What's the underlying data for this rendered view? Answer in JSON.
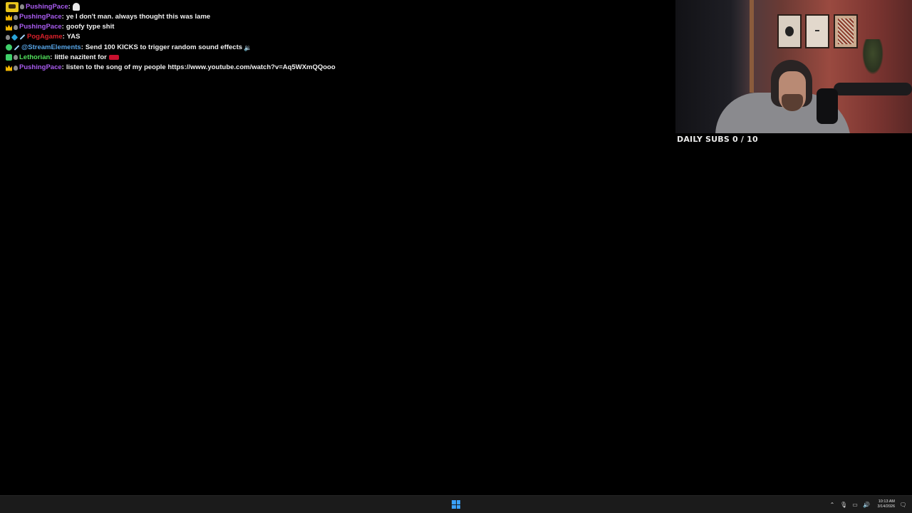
{
  "chat": {
    "messages": [
      {
        "user": "PushingPace",
        "user_color": "#a95cf0",
        "text": "",
        "emote": "ghost"
      },
      {
        "user": "PushingPace",
        "user_color": "#a95cf0",
        "text": "ye I don't man. always thought this was lame"
      },
      {
        "user": "PushingPace",
        "user_color": "#a95cf0",
        "text": "goofy type shit"
      },
      {
        "user": "PogAgame",
        "user_color": "#d8212b",
        "text": "YAS"
      },
      {
        "user": "@StreamElements",
        "user_color": "#58a6e8",
        "text": "Send 100 KICKS to trigger random sound effects",
        "emote": "speaker"
      },
      {
        "user": "Lethorian",
        "user_color": "#52e05c",
        "text": "little nazitent for",
        "emote": "red"
      },
      {
        "user": "PushingPace",
        "user_color": "#a95cf0",
        "text": "listen to the song of my people https://www.youtube.com/watch?v=Aq5WXmQQooo"
      }
    ]
  },
  "overlay": {
    "daily_subs": "DAILY SUBS 0 / 10"
  },
  "taskbar": {
    "icons": {
      "start": "windows-start-icon",
      "chevron": "chevron-up-icon",
      "mic": "microphone-icon",
      "network": "network-icon",
      "volume": "volume-icon",
      "notifications": "notification-icon"
    },
    "chevron_glyph": "⌃",
    "mic_glyph": "🎙",
    "network_glyph": "▭",
    "volume_glyph": "🔊",
    "notification_glyph": "🗨",
    "time": "10:13 AM",
    "date": "3/14/2026"
  },
  "colors": {
    "background": "#000000",
    "taskbar": "#1b1b1b",
    "start_accent": "#3aa0ff"
  }
}
